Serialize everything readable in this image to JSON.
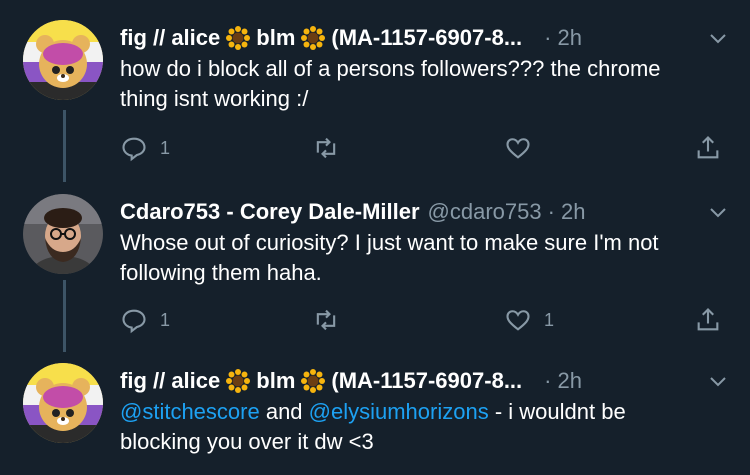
{
  "tweets": [
    {
      "name": "fig // alice",
      "name_mid": "blm",
      "name_tail": "(MA-1157-6907-8...",
      "handle": "",
      "time": "2h",
      "text": "how do i block all of a persons followers??? the chrome thing isnt working :/",
      "reply_count": "1",
      "retweet_count": "",
      "like_count": ""
    },
    {
      "name": "Cdaro753 - Corey Dale-Miller",
      "handle": "@cdaro753",
      "time": "2h",
      "text": "Whose out of curiosity? I just want to make sure I'm not following them haha.",
      "reply_count": "1",
      "retweet_count": "",
      "like_count": "1"
    },
    {
      "name": "fig // alice",
      "name_mid": "blm",
      "name_tail": "(MA-1157-6907-8...",
      "handle": "",
      "time": "2h",
      "mention1": "@stitchescore",
      "and_text": " and ",
      "mention2": "@elysiumhorizons",
      "text_rest": " - i wouldnt be blocking you over it dw <3"
    }
  ],
  "colors": {
    "background": "#15202b",
    "text": "#ffffff",
    "muted": "#8899a6",
    "link": "#1da1f2",
    "thread_line": "#3d5466"
  },
  "icons": [
    "avatar",
    "sunflower-emoji",
    "chevron-down-icon",
    "reply-icon",
    "retweet-icon",
    "like-icon",
    "share-icon"
  ]
}
